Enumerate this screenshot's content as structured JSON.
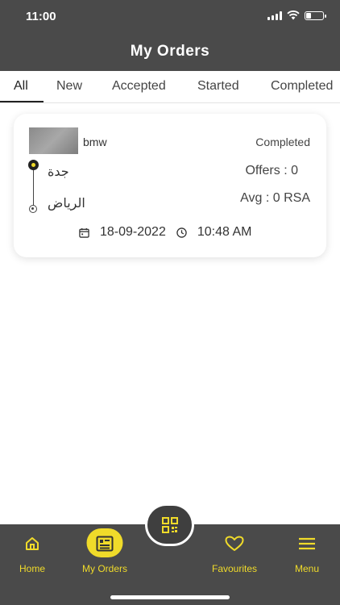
{
  "status_bar": {
    "time": "11:00"
  },
  "header": {
    "title": "My Orders"
  },
  "tabs": [
    {
      "label": "All",
      "active": true
    },
    {
      "label": "New"
    },
    {
      "label": "Accepted"
    },
    {
      "label": "Started"
    },
    {
      "label": "Completed"
    }
  ],
  "orders": [
    {
      "car": "bmw",
      "status": "Completed",
      "from": "جدة",
      "to": "الرياض",
      "offers": "Offers : 0",
      "avg": "Avg : 0 RSA",
      "date": "18-09-2022",
      "time": "10:48 AM"
    }
  ],
  "bottom_nav": [
    {
      "label": "Home",
      "icon": "home-icon"
    },
    {
      "label": "My Orders",
      "icon": "orders-icon",
      "active": true
    },
    {
      "label": "Favourites",
      "icon": "heart-icon"
    },
    {
      "label": "Menu",
      "icon": "menu-icon"
    }
  ],
  "center_button": {
    "icon": "qr-code-icon"
  },
  "colors": {
    "accent": "#f0db2a",
    "dark": "#4a4a4a"
  }
}
